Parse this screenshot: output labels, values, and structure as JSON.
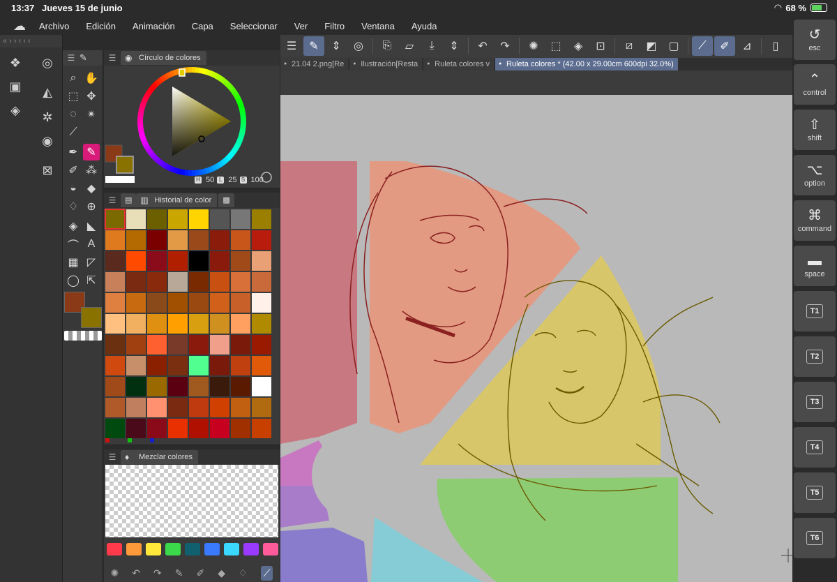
{
  "status": {
    "time": "13:37",
    "date": "Jueves 15 de junio",
    "battery": "68 %",
    "battery_level": 0.68
  },
  "menu": [
    "Archivo",
    "Edición",
    "Animación",
    "Capa",
    "Seleccionar",
    "Ver",
    "Filtro",
    "Ventana",
    "Ayuda"
  ],
  "colors": {
    "main": "#8a3a16",
    "sub": "#8a7200",
    "accent": "#5b6c8f",
    "active_tool": "#d81b78"
  },
  "wheel": {
    "title": "Círculo de colores",
    "h_label": "H",
    "h": "50",
    "l_label": "L",
    "l": "25",
    "s_label": "S",
    "s": "100"
  },
  "history": {
    "title": "Historial de color",
    "swatches": [
      "#7a6a00",
      "#e8dfb8",
      "#6b5f00",
      "#c9a600",
      "#ffd400",
      "#555555",
      "#777777",
      "#9a7f00",
      "#e07a1e",
      "#b46a00",
      "#7a0000",
      "#e29a46",
      "#9a4a1a",
      "#8a1c0c",
      "#c8561a",
      "#b81c0c",
      "#5a2a1e",
      "#ff4a00",
      "#8a0c1a",
      "#b02000",
      "#000000",
      "#8a1a0c",
      "#a04a1a",
      "#e8a074",
      "#c8805a",
      "#7a2a10",
      "#8a2a0c",
      "#b8a898",
      "#7a2a00",
      "#c85010",
      "#d8703a",
      "#c86a3a",
      "#e08040",
      "#c86a10",
      "#8a4a1a",
      "#a05000",
      "#9a4a10",
      "#d0601a",
      "#c8602a",
      "#fff0ea",
      "#ffc080",
      "#f0b060",
      "#e09010",
      "#ffa000",
      "#d8a010",
      "#d09020",
      "#ffa060",
      "#b08a00",
      "#6a3010",
      "#a04010",
      "#ff6030",
      "#7a3a2a",
      "#8a1a0c",
      "#f0a08a",
      "#7a1a0a",
      "#9a1a00",
      "#d04a10",
      "#c8906a",
      "#8a2000",
      "#7a3010",
      "#50ff90",
      "#7a1a0a",
      "#c04010",
      "#e05a0a",
      "#a04a1a",
      "#003010",
      "#9a6a00",
      "#5a0010",
      "#a05a20",
      "#3a1a0a",
      "#5a1a00",
      "#ffffff",
      "#b05a2a",
      "#c08060",
      "#ff9070",
      "#7a2a10",
      "#c03a10",
      "#d04000",
      "#c06010",
      "#b06a10",
      "#004a10",
      "#4a0a1a",
      "#8a0a1a",
      "#e83000",
      "#b01000",
      "#c80020",
      "#a03000",
      "#c84000"
    ],
    "markers": [
      "#d01010",
      "#10c010",
      "#1020d0"
    ]
  },
  "mix": {
    "title": "Mezclar colores",
    "swatches": [
      "#ff3a4a",
      "#ff9a3a",
      "#ffe83a",
      "#3ad84a",
      "#106070",
      "#3a7aff",
      "#3ad8ff",
      "#9a3aff",
      "#ff5a9a"
    ]
  },
  "docs": {
    "tabs": [
      "21.04 2.png[Re",
      "Ilustración[Resta",
      "Ruleta colores v",
      "Ruleta colores * (42.00 x 29.00cm 600dpi 32.0%)"
    ],
    "active": 3
  },
  "shortcuts": {
    "esc": "esc",
    "control": "control",
    "shift": "shift",
    "option": "option",
    "command": "command",
    "space": "space",
    "t": [
      "T1",
      "T2",
      "T3",
      "T4",
      "T5",
      "T6"
    ]
  },
  "icons": {
    "history_panel": "history-icon",
    "wheel_panel": "color-wheel-icon",
    "mix_panel": "color-mix-icon",
    "brush": "brush-icon",
    "undo": "undo-icon",
    "redo": "redo-icon",
    "save": "save-icon",
    "open": "open-folder-icon"
  }
}
